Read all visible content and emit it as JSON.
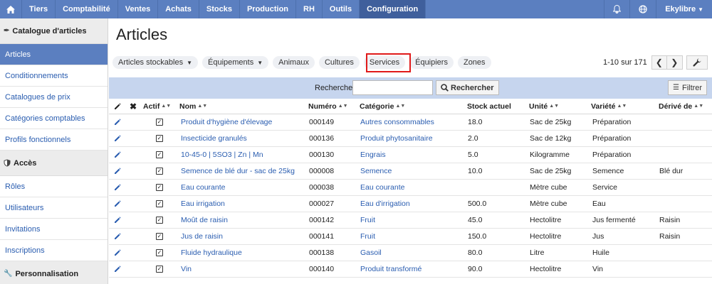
{
  "nav": {
    "home_icon": "home-icon",
    "items": [
      "Tiers",
      "Comptabilité",
      "Ventes",
      "Achats",
      "Stocks",
      "Production",
      "RH",
      "Outils",
      "Configuration"
    ],
    "active": "Configuration",
    "user": "Ekylibre"
  },
  "sidebar": {
    "catalog_title": "Catalogue d'articles",
    "catalog_items": [
      "Articles",
      "Conditionnements",
      "Catalogues de prix",
      "Catégories comptables",
      "Profils fonctionnels"
    ],
    "access_title": "Accès",
    "access_items": [
      "Rôles",
      "Utilisateurs",
      "Invitations",
      "Inscriptions"
    ],
    "personal_title": "Personnalisation"
  },
  "main": {
    "title": "Articles",
    "filters": {
      "stockables": "Articles stockables",
      "equipements": "Équipements",
      "animaux": "Animaux",
      "cultures": "Cultures",
      "services": "Services",
      "equipiers": "Équipiers",
      "zones": "Zones"
    },
    "pager": "1-10 sur 171",
    "search_label": "Rechercher",
    "search_value": "",
    "search_button": "Rechercher",
    "filter_button": "Filtrer"
  },
  "table": {
    "headers": {
      "actif": "Actif",
      "nom": "Nom",
      "numero": "Numéro",
      "categorie": "Catégorie",
      "stock": "Stock actuel",
      "unite": "Unité",
      "variete": "Variété",
      "derive": "Dérivé de"
    },
    "rows": [
      {
        "nom": "Produit d'hygiène d'élevage",
        "numero": "000149",
        "categorie": "Autres consommables",
        "stock": "18.0",
        "unite": "Sac de 25kg",
        "variete": "Préparation",
        "derive": ""
      },
      {
        "nom": "Insecticide granulés",
        "numero": "000136",
        "categorie": "Produit phytosanitaire",
        "stock": "2.0",
        "unite": "Sac de 12kg",
        "variete": "Préparation",
        "derive": ""
      },
      {
        "nom": "10-45-0 | 5SO3 | Zn | Mn",
        "numero": "000130",
        "categorie": "Engrais",
        "stock": "5.0",
        "unite": "Kilogramme",
        "variete": "Préparation",
        "derive": ""
      },
      {
        "nom": "Semence de blé dur - sac de 25kg",
        "numero": "000008",
        "categorie": "Semence",
        "stock": "10.0",
        "unite": "Sac de 25kg",
        "variete": "Semence",
        "derive": "Blé dur"
      },
      {
        "nom": "Eau courante",
        "numero": "000038",
        "categorie": "Eau courante",
        "stock": "",
        "unite": "Mètre cube",
        "variete": "Service",
        "derive": ""
      },
      {
        "nom": "Eau irrigation",
        "numero": "000027",
        "categorie": "Eau d'irrigation",
        "stock": "500.0",
        "unite": "Mètre cube",
        "variete": "Eau",
        "derive": ""
      },
      {
        "nom": "Moût de raisin",
        "numero": "000142",
        "categorie": "Fruit",
        "stock": "45.0",
        "unite": "Hectolitre",
        "variete": "Jus fermenté",
        "derive": "Raisin"
      },
      {
        "nom": "Jus de raisin",
        "numero": "000141",
        "categorie": "Fruit",
        "stock": "150.0",
        "unite": "Hectolitre",
        "variete": "Jus",
        "derive": "Raisin"
      },
      {
        "nom": "Fluide hydraulique",
        "numero": "000138",
        "categorie": "Gasoil",
        "stock": "80.0",
        "unite": "Litre",
        "variete": "Huile",
        "derive": ""
      },
      {
        "nom": "Vin",
        "numero": "000140",
        "categorie": "Produit transformé",
        "stock": "90.0",
        "unite": "Hectolitre",
        "variete": "Vin",
        "derive": ""
      }
    ]
  }
}
